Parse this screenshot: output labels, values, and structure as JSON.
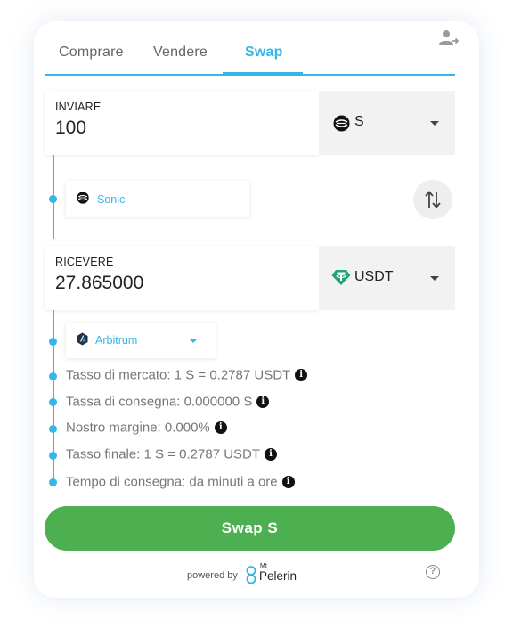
{
  "tabs": [
    {
      "label": "Comprare"
    },
    {
      "label": "Vendere"
    },
    {
      "label": "Swap"
    }
  ],
  "send": {
    "label": "INVIARE",
    "amount": "100",
    "currency": "S",
    "network": "Sonic"
  },
  "receive": {
    "label": "RICEVERE",
    "amount": "27.865000",
    "currency": "USDT",
    "network": "Arbitrum"
  },
  "info": [
    {
      "text": "Tasso di mercato: 1 S = 0.2787 USDT"
    },
    {
      "text": "Tassa di consegna: 0.000000 S"
    },
    {
      "text": "Nostro margine: 0.000%"
    },
    {
      "text": "Tasso finale: 1 S = 0.2787 USDT"
    },
    {
      "text": "Tempo di consegna: da minuti a ore"
    }
  ],
  "actions": {
    "swap_label": "Swap S"
  },
  "footer": {
    "powered_by": "powered by",
    "brand_small": "Mt",
    "brand": "Pelerin",
    "help": "?"
  },
  "colors": {
    "accent": "#35b6e8",
    "button": "#4caf50",
    "tether": "#26a17b"
  },
  "icons": {
    "account": "user-logout-icon",
    "sonic": "sonic-logo-icon",
    "tether": "tether-logo-icon",
    "arbitrum": "arbitrum-logo-icon",
    "swap": "swap-vertical-icon",
    "info": "info-icon",
    "help": "help-icon"
  }
}
